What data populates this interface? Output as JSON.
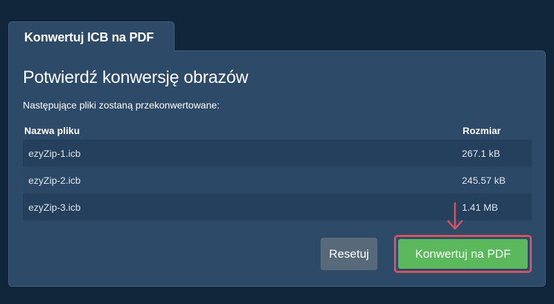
{
  "tab": {
    "label": "Konwertuj ICB na PDF"
  },
  "panel": {
    "title": "Potwierdź konwersję obrazów",
    "subtitle": "Następujące pliki zostaną przekonwertowane:"
  },
  "table": {
    "columns": [
      "Nazwa pliku",
      "Rozmiar"
    ],
    "rows": [
      {
        "name": "ezyZip-1.icb",
        "size": "267.1 kB"
      },
      {
        "name": "ezyZip-2.icb",
        "size": "245.57 kB"
      },
      {
        "name": "ezyZip-3.icb",
        "size": "1.41 MB"
      }
    ]
  },
  "buttons": {
    "reset_label": "Resetuj",
    "convert_label": "Konwertuj na PDF"
  },
  "colors": {
    "background": "#11263a",
    "panel": "#2d4a68",
    "convert_button": "#5cb85c",
    "reset_button": "#586a79",
    "highlight": "#d9535f"
  },
  "icons": {
    "pointer": "arrow-down-icon"
  }
}
